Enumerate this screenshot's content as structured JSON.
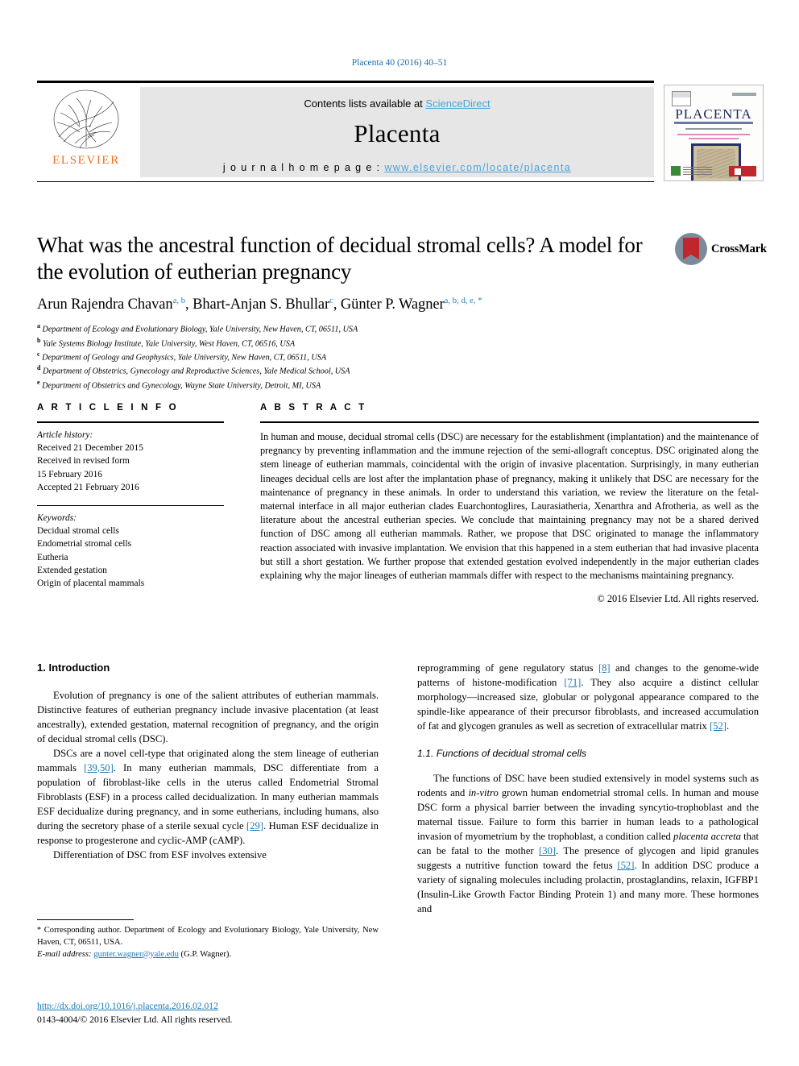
{
  "running_head": "Placenta 40 (2016) 40–51",
  "masthead": {
    "contents_prefix": "Contents lists available at ",
    "sciencedirect": "ScienceDirect",
    "journal_name": "Placenta",
    "homepage_prefix": "j o u r n a l   h o m e p a g e :  ",
    "homepage_url": "www.elsevier.com/locate/placenta",
    "publisher": "ELSEVIER",
    "publisher_color": "#f37021",
    "link_color": "#4ea3d8"
  },
  "cover": {
    "title": "PLACENTA"
  },
  "crossmark": {
    "label": "CrossMark"
  },
  "article": {
    "title": "What was the ancestral function of decidual stromal cells? A model for the evolution of eutherian pregnancy",
    "authors": [
      {
        "name": "Arun Rajendra Chavan",
        "marks": "a, b",
        "sep": ", "
      },
      {
        "name": "Bhart-Anjan S. Bhullar",
        "marks": "c",
        "sep": ", "
      },
      {
        "name": "Günter P. Wagner",
        "marks": "a, b, d, e, *",
        "sep": ""
      }
    ],
    "affiliations": [
      {
        "mark": "a",
        "text": "Department of Ecology and Evolutionary Biology, Yale University, New Haven, CT, 06511, USA"
      },
      {
        "mark": "b",
        "text": "Yale Systems Biology Institute, Yale University, West Haven, CT, 06516, USA"
      },
      {
        "mark": "c",
        "text": "Department of Geology and Geophysics, Yale University, New Haven, CT, 06511, USA"
      },
      {
        "mark": "d",
        "text": "Department of Obstetrics, Gynecology and Reproductive Sciences, Yale Medical School, USA"
      },
      {
        "mark": "e",
        "text": "Department of Obstetrics and Gynecology, Wayne State University, Detroit, MI, USA"
      }
    ]
  },
  "article_info": {
    "heading": "A R T I C L E  I N F O",
    "history_label": "Article history:",
    "history": [
      "Received 21 December 2015",
      "Received in revised form",
      "15 February 2016",
      "Accepted 21 February 2016"
    ],
    "keywords_label": "Keywords:",
    "keywords": [
      "Decidual stromal cells",
      "Endometrial stromal cells",
      "Eutheria",
      "Extended gestation",
      "Origin of placental mammals"
    ]
  },
  "abstract": {
    "heading": "A B S T R A C T",
    "text": "In human and mouse, decidual stromal cells (DSC) are necessary for the establishment (implantation) and the maintenance of pregnancy by preventing inflammation and the immune rejection of the semi-allograft conceptus. DSC originated along the stem lineage of eutherian mammals, coincidental with the origin of invasive placentation. Surprisingly, in many eutherian lineages decidual cells are lost after the implantation phase of pregnancy, making it unlikely that DSC are necessary for the maintenance of pregnancy in these animals. In order to understand this variation, we review the literature on the fetal-maternal interface in all major eutherian clades Euarchontoglires, Laurasiatheria, Xenarthra and Afrotheria, as well as the literature about the ancestral eutherian species. We conclude that maintaining pregnancy may not be a shared derived function of DSC among all eutherian mammals. Rather, we propose that DSC originated to manage the inflammatory reaction associated with invasive implantation. We envision that this happened in a stem eutherian that had invasive placenta but still a short gestation. We further propose that extended gestation evolved independently in the major eutherian clades explaining why the major lineages of eutherian mammals differ with respect to the mechanisms maintaining pregnancy.",
    "copyright": "© 2016 Elsevier Ltd. All rights reserved."
  },
  "body": {
    "section1_heading": "1. Introduction",
    "left_p1": "Evolution of pregnancy is one of the salient attributes of eutherian mammals. Distinctive features of eutherian pregnancy include invasive placentation (at least ancestrally), extended gestation, maternal recognition of pregnancy, and the origin of decidual stromal cells (DSC).",
    "left_p2_a": "DSCs are a novel cell-type that originated along the stem lineage of eutherian mammals ",
    "left_p2_ref1": "[39,50]",
    "left_p2_b": ". In many eutherian mammals, DSC differentiate from a population of fibroblast-like cells in the uterus called Endometrial Stromal Fibroblasts (ESF) in a process called decidualization. In many eutherian mammals ESF decidualize during pregnancy, and in some eutherians, including humans, also during the secretory phase of a sterile sexual cycle ",
    "left_p2_ref2": "[29]",
    "left_p2_c": ". Human ESF decidualize in response to progesterone and cyclic-AMP (cAMP).",
    "left_p3": "Differentiation of DSC from ESF involves extensive",
    "right_p1_a": "reprogramming of gene regulatory status ",
    "right_p1_ref1": "[8]",
    "right_p1_b": " and changes to the genome-wide patterns of histone-modification ",
    "right_p1_ref2": "[71]",
    "right_p1_c": ". They also acquire a distinct cellular morphology—increased size, globular or polygonal appearance compared to the spindle-like appearance of their precursor fibroblasts, and increased accumulation of fat and glycogen granules as well as secretion of extracellular matrix ",
    "right_p1_ref3": "[52]",
    "right_p1_d": ".",
    "section11_heading": "1.1. Functions of decidual stromal cells",
    "right_p2_a": "The functions of DSC have been studied extensively in model systems such as rodents and ",
    "right_p2_ital1": "in-vitro",
    "right_p2_b": " grown human endometrial stromal cells. In human and mouse DSC form a physical barrier between the invading syncytio-trophoblast and the maternal tissue. Failure to form this barrier in human leads to a pathological invasion of myometrium by the trophoblast, a condition called ",
    "right_p2_ital2": "placenta accreta",
    "right_p2_c": " that can be fatal to the mother ",
    "right_p2_ref1": "[30]",
    "right_p2_d": ". The presence of glycogen and lipid granules suggests a nutritive function toward the fetus ",
    "right_p2_ref2": "[52]",
    "right_p2_e": ". In addition DSC produce a variety of signaling molecules including prolactin, prostaglandins, relaxin, IGFBP1 (Insulin-Like Growth Factor Binding Protein 1) and many more. These hormones and"
  },
  "footnote": {
    "star": "*",
    "corresponding": " Corresponding author. Department of Ecology and Evolutionary Biology, Yale University, New Haven, CT, 06511, USA.",
    "email_label": "E-mail address:",
    "email": "gunter.wagner@yale.edu",
    "email_owner": " (G.P. Wagner)."
  },
  "doi": {
    "url": "http://dx.doi.org/10.1016/j.placenta.2016.02.012",
    "issn_line": "0143-4004/© 2016 Elsevier Ltd. All rights reserved."
  }
}
